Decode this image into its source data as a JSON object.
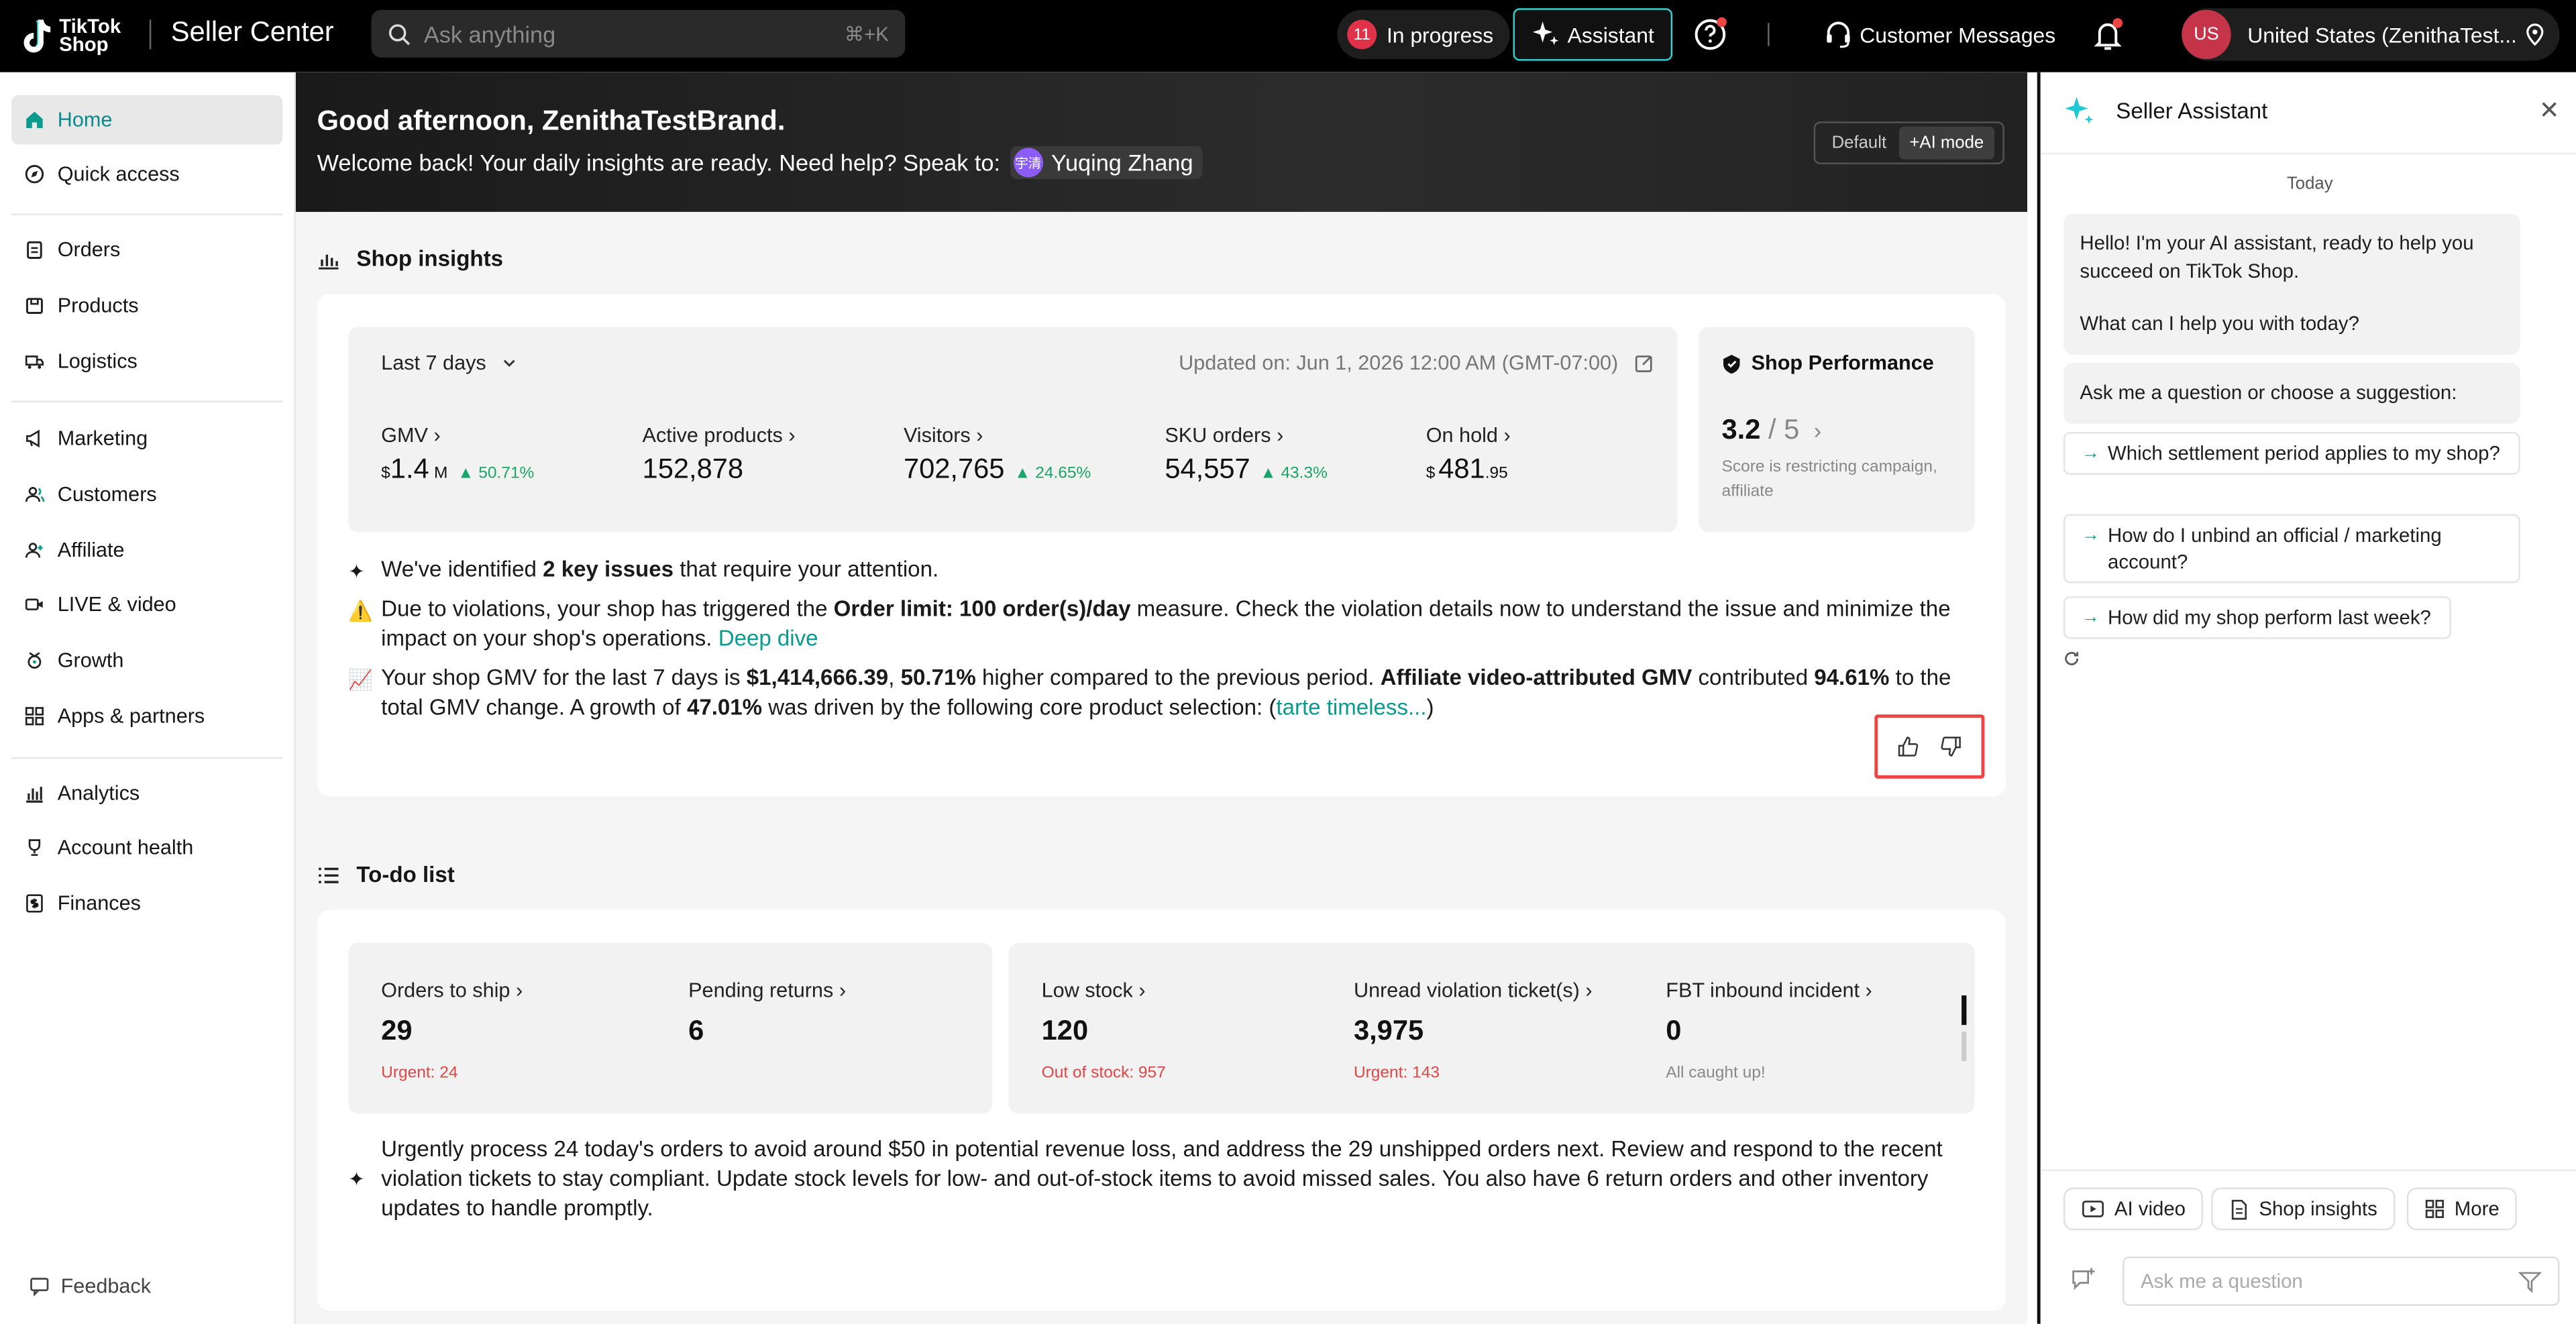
{
  "topbar": {
    "logo_line1": "TikTok",
    "logo_line2": "Shop",
    "app_title": "Seller Center",
    "search_placeholder": "Ask anything",
    "search_shortcut": "⌘+K",
    "inprogress_count": "11",
    "inprogress_label": "In progress",
    "assistant_label": "Assistant",
    "customer_messages": "Customer Messages",
    "account_initials": "US",
    "account_label": "United States  (ZenithaTest..."
  },
  "sidebar": {
    "items": [
      {
        "label": "Home",
        "icon": "home-icon"
      },
      {
        "label": "Quick access",
        "icon": "compass-icon"
      },
      {
        "label": "Orders",
        "icon": "clipboard-icon"
      },
      {
        "label": "Products",
        "icon": "box-icon"
      },
      {
        "label": "Logistics",
        "icon": "truck-icon"
      },
      {
        "label": "Marketing",
        "icon": "megaphone-icon"
      },
      {
        "label": "Customers",
        "icon": "users-icon"
      },
      {
        "label": "Affiliate",
        "icon": "user-plus-icon"
      },
      {
        "label": "LIVE & video",
        "icon": "video-icon"
      },
      {
        "label": "Growth",
        "icon": "rocket-icon"
      },
      {
        "label": "Apps & partners",
        "icon": "apps-icon"
      },
      {
        "label": "Analytics",
        "icon": "bar-chart-icon"
      },
      {
        "label": "Account health",
        "icon": "trophy-icon"
      },
      {
        "label": "Finances",
        "icon": "dollar-icon"
      }
    ],
    "feedback": "Feedback"
  },
  "hero": {
    "greeting": "Good afternoon, ZenithaTestBrand.",
    "welcome": "Welcome back! Your daily insights are ready. Need help? Speak to:",
    "contact_initials": "宇清",
    "contact_name": "Yuqing Zhang",
    "mode_default": "Default",
    "mode_ai": "+AI mode"
  },
  "insights": {
    "title": "Shop insights",
    "period": "Last 7 days",
    "updated": "Updated on: Jun 1, 2026 12:00 AM (GMT-07:00)",
    "metrics": [
      {
        "label": "GMV",
        "prefix": "$",
        "value": "1.4",
        "suffix": "M",
        "change": "50.71%"
      },
      {
        "label": "Active products",
        "value": "152,878"
      },
      {
        "label": "Visitors",
        "value": "702,765",
        "change": "24.65%"
      },
      {
        "label": "SKU orders",
        "value": "54,557",
        "change": "43.3%"
      },
      {
        "label": "On hold",
        "prefix": "$",
        "value": "481",
        "suffix": ".95"
      }
    ],
    "performance": {
      "title": "Shop Performance",
      "score": "3.2",
      "max": "/ 5",
      "note": "Score is restricting campaign, affiliate"
    },
    "line1_a": "We've identified ",
    "line1_b": "2 key issues",
    "line1_c": " that require your attention.",
    "line2_a": "Due to violations, your shop has triggered the ",
    "line2_b": "Order limit: 100 order(s)/day",
    "line2_c": " measure. Check the violation details now to understand the issue and minimize the impact on your shop's operations. ",
    "line2_link": "Deep dive",
    "line3_a": "Your shop GMV for the last 7 days is ",
    "line3_b": "$1,414,666.39",
    "line3_c": ", ",
    "line3_d": "50.71%",
    "line3_e": " higher compared to the previous period. ",
    "line3_f": "Affiliate video-attributed GMV",
    "line3_g": " contributed ",
    "line3_h": "94.61%",
    "line3_i": " to the total GMV change. A growth of ",
    "line3_j": "47.01%",
    "line3_k": " was driven by the following core product selection: (",
    "line3_link": "tarte timeless...",
    "line3_l": ")"
  },
  "todo": {
    "title": "To-do list",
    "group1": [
      {
        "label": "Orders to ship",
        "value": "29",
        "sub": "Urgent: 24"
      },
      {
        "label": "Pending returns",
        "value": "6",
        "sub": ""
      }
    ],
    "group2": [
      {
        "label": "Low stock",
        "value": "120",
        "sub": "Out of stock: 957"
      },
      {
        "label": "Unread violation ticket(s)",
        "value": "3,975",
        "sub": "Urgent: 143"
      },
      {
        "label": "FBT inbound incident",
        "value": "0",
        "sub": "All caught up!"
      }
    ],
    "summary": "Urgently process 24 today's orders to avoid around $50 in potential revenue loss, and address the 29 unshipped orders next. Review and respond to the recent violation tickets to stay compliant. Update stock levels for low- and out-of-stock items to avoid missed sales. You also have 6 return orders and other inventory updates to handle promptly."
  },
  "assistant": {
    "title": "Seller Assistant",
    "today": "Today",
    "greeting_1": "Hello! I'm your AI assistant, ready to help you succeed on TikTok Shop.",
    "greeting_2": "What can I help you with today?",
    "prompt": "Ask me a question or choose a suggestion:",
    "suggestions": [
      "Which settlement period applies to my shop?",
      "How do I unbind an official / marketing account?",
      "How did my shop perform last week?"
    ],
    "chips": [
      "AI video",
      "Shop insights",
      "More"
    ],
    "ask_placeholder": "Ask me a question"
  },
  "colors": {
    "accent": "#0a9b8f",
    "positive": "#1aa56b",
    "urgent": "#e04646",
    "highlight_border": "#ef4444"
  }
}
